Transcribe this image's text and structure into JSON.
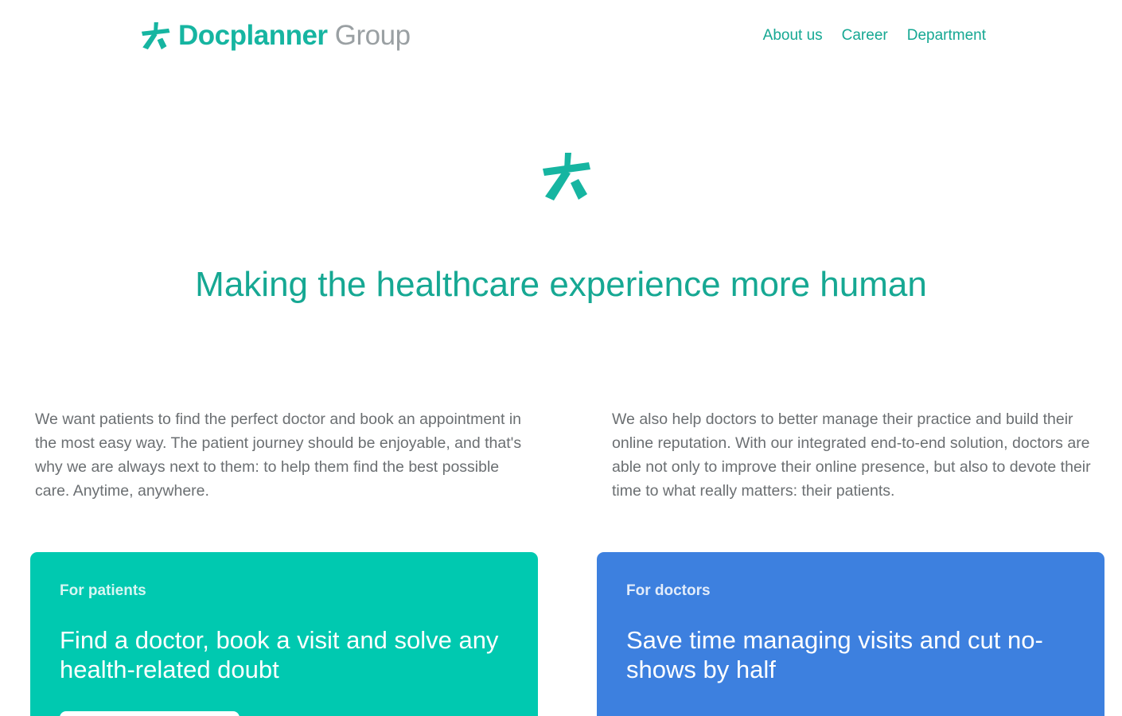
{
  "header": {
    "logo": {
      "brand": "Docplanner",
      "suffix": "Group"
    },
    "nav": [
      {
        "label": "About us"
      },
      {
        "label": "Career"
      },
      {
        "label": "Department"
      }
    ]
  },
  "hero": {
    "title": "Making the healthcare experience more human"
  },
  "intro": {
    "patients_text": "We want patients to find the perfect doctor and book an appointment in the most easy way. The patient journey should be enjoyable, and that's why we are always next to them: to help them find the best possible care. Anytime, anywhere.",
    "doctors_text": "We also help doctors to better manage their practice and build their online reputation. With our integrated end-to-end solution, doctors are able not only to improve their online presence, but also to devote their time to what really matters: their patients."
  },
  "cards": {
    "patients": {
      "eyebrow": "For patients",
      "title": "Find a doctor, book a visit and solve any health-related doubt"
    },
    "doctors": {
      "eyebrow": "For doctors",
      "title": "Save time managing visits and cut no-shows by half"
    }
  },
  "icons": {
    "logo_mark": "docplanner-star-icon",
    "hero_mark": "docplanner-star-icon"
  },
  "colors": {
    "brand_teal": "#16b5a1",
    "nav_teal": "#16a893",
    "logo_gray": "#9aa0a3",
    "body_text": "#6b6f72",
    "patients_card": "#00c9b0",
    "doctors_card": "#3d80df"
  }
}
